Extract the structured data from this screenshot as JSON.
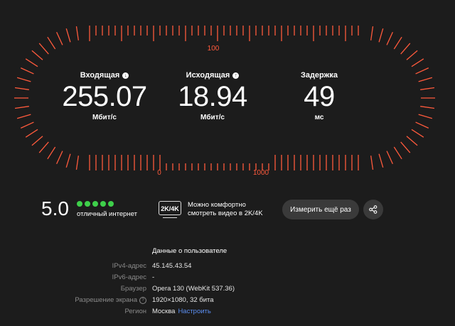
{
  "gauge": {
    "mark_top": "100",
    "mark_left": "0",
    "mark_right": "1000",
    "accent": "#ff5a3c"
  },
  "metrics": {
    "incoming": {
      "label": "Входящая",
      "icon": "arrow-down-icon",
      "value": "255.07",
      "unit": "Мбит/с"
    },
    "outgoing": {
      "label": "Исходящая",
      "icon": "arrow-up-icon",
      "value": "18.94",
      "unit": "Мбит/с"
    },
    "latency": {
      "label": "Задержка",
      "value": "49",
      "unit": "мс"
    }
  },
  "score": {
    "value": "5.0",
    "dots": 5,
    "label": "отличный интернет",
    "color": "#3ecf4a"
  },
  "quality": {
    "badge": "2K/4K",
    "line1": "Можно комфортно",
    "line2": "смотреть видео в 2K/4K"
  },
  "actions": {
    "retest_label": "Измерить ещё раз",
    "share_icon": "share-icon"
  },
  "user_info": {
    "title": "Данные о пользователе",
    "ipv4": {
      "key": "IPv4-адрес",
      "value": "45.145.43.54"
    },
    "ipv6": {
      "key": "IPv6-адрес",
      "value": "-"
    },
    "browser": {
      "key": "Браузер",
      "value": "Opera 130 (WebKit 537.36)"
    },
    "screen": {
      "key": "Разрешение экрана",
      "value": "1920×1080, 32 бита"
    },
    "region": {
      "key": "Регион",
      "value": "Москва",
      "link": "Настроить"
    }
  }
}
